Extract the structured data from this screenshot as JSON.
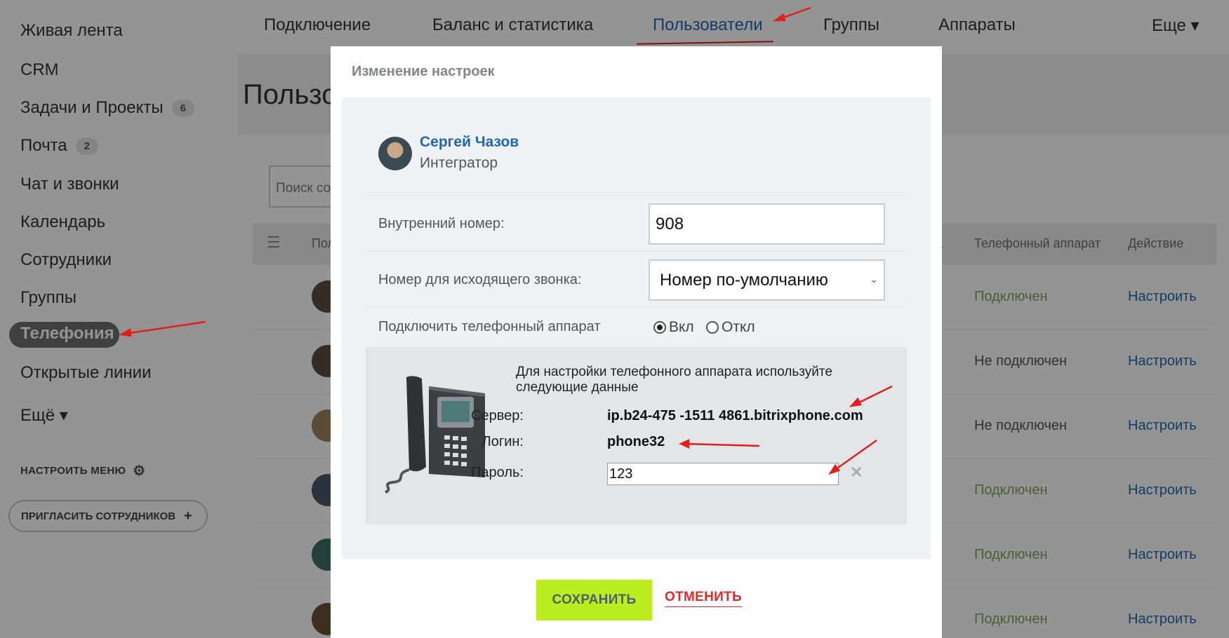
{
  "sidebar": {
    "items": [
      {
        "label": "Живая лента"
      },
      {
        "label": "CRM"
      },
      {
        "label": "Задачи и Проекты",
        "count": "6"
      },
      {
        "label": "Почта",
        "count": "2"
      },
      {
        "label": "Чат и звонки"
      },
      {
        "label": "Календарь"
      },
      {
        "label": "Сотрудники"
      },
      {
        "label": "Группы"
      },
      {
        "label": "Телефония",
        "active": true
      },
      {
        "label": "Открытые линии"
      },
      {
        "label": "Ещё ▾"
      }
    ],
    "configure_menu": "НАСТРОИТЬ МЕНЮ",
    "invite": "ПРИГЛАСИТЬ СОТРУДНИКОВ"
  },
  "topnav": {
    "tabs": [
      {
        "label": "Подключение"
      },
      {
        "label": "Баланс и статистика"
      },
      {
        "label": "Пользователи",
        "active": true
      },
      {
        "label": "Группы"
      },
      {
        "label": "Аппараты"
      },
      {
        "label": "Еще ▾"
      }
    ]
  },
  "page": {
    "title": "Пользо",
    "search_placeholder": "Поиск со",
    "grid": {
      "columns": [
        "Пол",
        "а",
        "Телефонный аппарат",
        "Действие"
      ],
      "rows": [
        {
          "status": "Подключен",
          "state": "on",
          "action": "Настроить"
        },
        {
          "status": "Не подключен",
          "state": "off",
          "action": "Настроить"
        },
        {
          "status": "Не подключен",
          "state": "off",
          "action": "Настроить"
        },
        {
          "status": "Подключен",
          "state": "on",
          "action": "Настроить"
        },
        {
          "status": "Подключен",
          "state": "on",
          "action": "Настроить"
        },
        {
          "status": "Подключен",
          "state": "on",
          "action": "Настроить"
        }
      ]
    }
  },
  "modal": {
    "title": "Изменение настроек",
    "user": {
      "name": "Сергей Чазов",
      "role": "Интегратор"
    },
    "internal_number_label": "Внутренний номер:",
    "internal_number_value": "908",
    "outgoing_label": "Номер для исходящего звонка:",
    "outgoing_value": "Номер по-умолчанию",
    "connect_phone_label": "Подключить телефонный аппарат",
    "radio_on": "Вкл",
    "radio_off": "Откл",
    "radio_selected": "on",
    "phone_desc": "Для настройки телефонного аппарата используйте следующие данные",
    "server_label": "Сервер:",
    "server_value": "ip.b24-475  -1511   4861.bitrixphone.com",
    "login_label": "Логин:",
    "login_value": "phone32",
    "password_label": "Пароль:",
    "password_value": "123",
    "save": "СОХРАНИТЬ",
    "cancel": "ОТМЕНИТЬ"
  },
  "colors": {
    "accent_blue": "#2067b0",
    "save_green": "#bbed21",
    "cancel_red": "#e02b27",
    "status_connected": "#7fa75a",
    "annotation_red": "#e0201a"
  }
}
